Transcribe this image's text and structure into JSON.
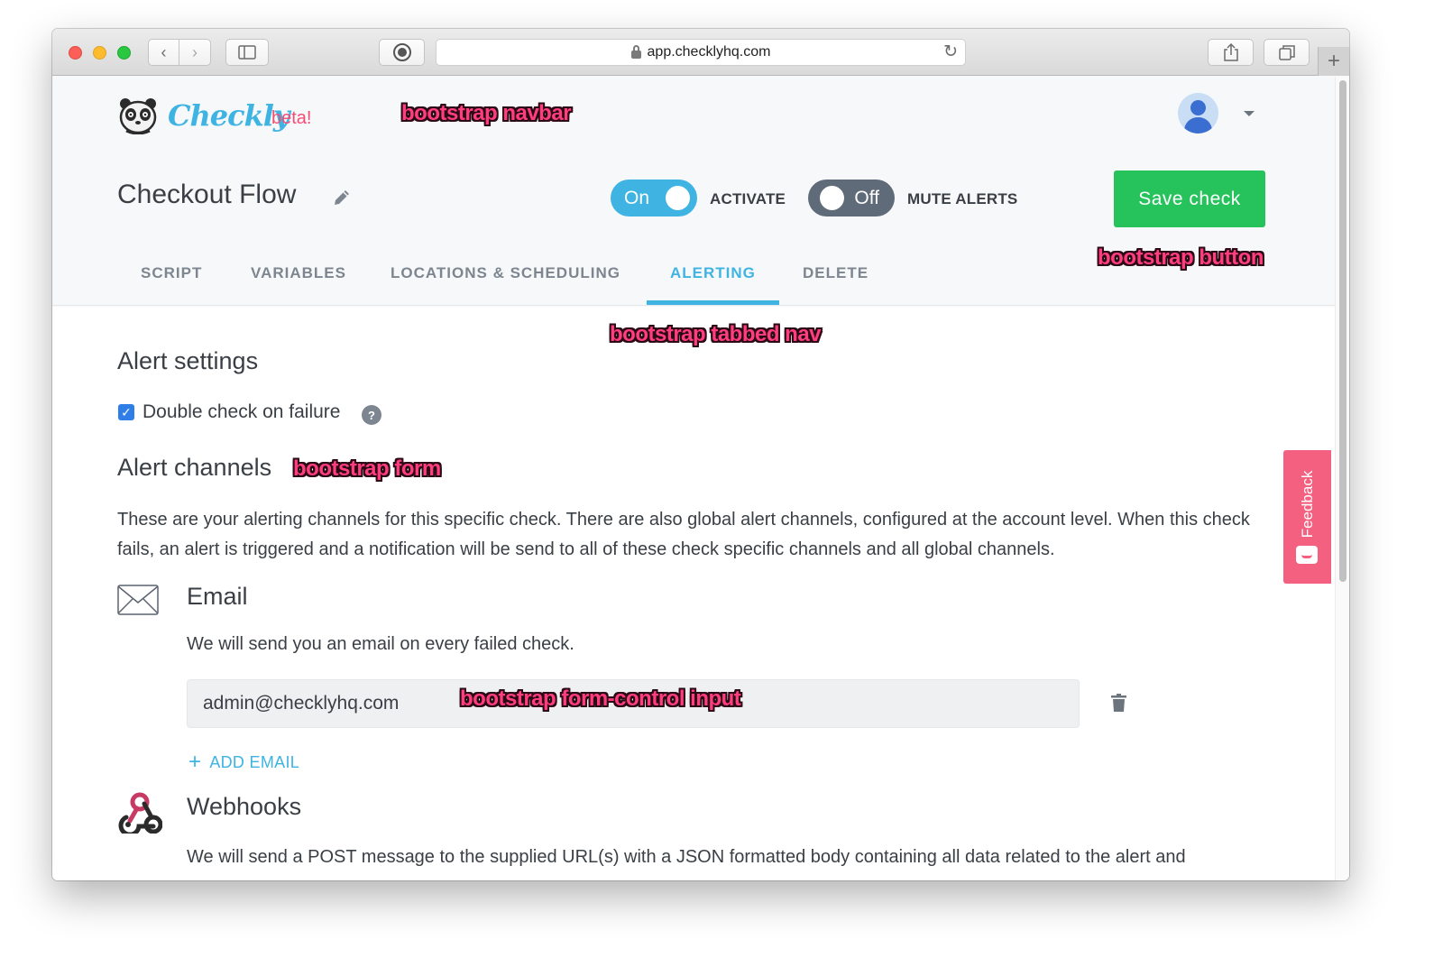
{
  "browser": {
    "url": "app.checklyhq.com"
  },
  "navbar": {
    "logo_text": "Checkly",
    "beta_label": "beta!"
  },
  "check": {
    "title": "Checkout Flow",
    "activate_toggle": {
      "state": "On",
      "caption": "ACTIVATE"
    },
    "mute_toggle": {
      "state": "Off",
      "caption": "MUTE ALERTS"
    },
    "save_label": "Save check"
  },
  "tabs": [
    {
      "label": "SCRIPT"
    },
    {
      "label": "VARIABLES"
    },
    {
      "label": "LOCATIONS & SCHEDULING"
    },
    {
      "label": "ALERTING",
      "active": true
    },
    {
      "label": "DELETE"
    }
  ],
  "alerting": {
    "settings_heading": "Alert settings",
    "double_check_label": "Double check on failure",
    "double_check_checked": true,
    "help_glyph": "?",
    "channels_heading": "Alert channels",
    "channels_description": "These are your alerting channels for this specific check. There are also global alert channels, configured at the account level. When this check fails, an alert is triggered and a notification will be send to all of these check specific channels and all global channels.",
    "email": {
      "heading": "Email",
      "description": "We will send you an email on every failed check.",
      "value": "admin@checklyhq.com",
      "add_label": "ADD EMAIL"
    },
    "webhooks": {
      "heading": "Webhooks",
      "description": "We will send a POST message to the supplied URL(s) with a JSON formatted body containing all data related to the alert and"
    }
  },
  "feedback_label": "Feedback",
  "annotations": {
    "navbar": "bootstrap navbar",
    "button": "bootstrap button",
    "tabbed_nav": "bootstrap tabbed nav",
    "form": "bootstrap form",
    "input": "bootstrap form-control input"
  },
  "colors": {
    "accent": "#3fb4e3",
    "save_green": "#26c35c",
    "beta_pink": "#f34d76",
    "annotation_pink": "#ff3d7f"
  },
  "icons": {
    "logo": "panda-logo-icon",
    "edit": "pencil-icon",
    "help": "question-circle-icon",
    "email": "envelope-icon",
    "delete": "trash-icon",
    "add": "plus-icon",
    "webhooks": "webhook-icon",
    "user": "user-avatar-icon"
  }
}
